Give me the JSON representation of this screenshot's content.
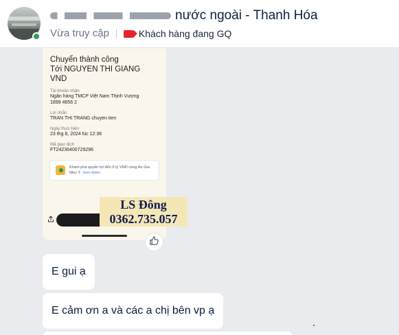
{
  "header": {
    "title": "nước ngoài - Thanh Hóa",
    "status": "Vừa truy cập",
    "tag": "Khách hàng đang GQ",
    "tag_color": "#e5252a"
  },
  "receipt": {
    "heading_line1": "Chuyển thành công",
    "heading_line2": "Tới NGUYEN THI GIANG",
    "heading_currency": "VND",
    "account_label": "Tài khoản nhận",
    "bank_name": "Ngân hàng TMCP Việt Nam Thịnh Vượng",
    "account_number": "1899 4656 2",
    "message_label": "Lời nhắn",
    "message": "TRAN THI TRANG chuyen tien",
    "date_label": "Ngày thực hiện",
    "date": "23 thg 8, 2024 lúc 12:36",
    "txn_label": "Mã giao dịch",
    "txn_id": "FT24236400729296",
    "promo_text": "Khám phá quyền lợi đến 6 tỷ VND cùng An Gia Như Ý.",
    "promo_link": "Xem thêm"
  },
  "watermark": {
    "line1": "LS Đông",
    "line2": "0362.735.057"
  },
  "messages": [
    {
      "text": "E gui ạ"
    },
    {
      "text": "E cảm ơn a và các a chị bên vp ạ"
    }
  ],
  "icons": {
    "like": "thumbs-up-icon",
    "share": "share-icon"
  }
}
